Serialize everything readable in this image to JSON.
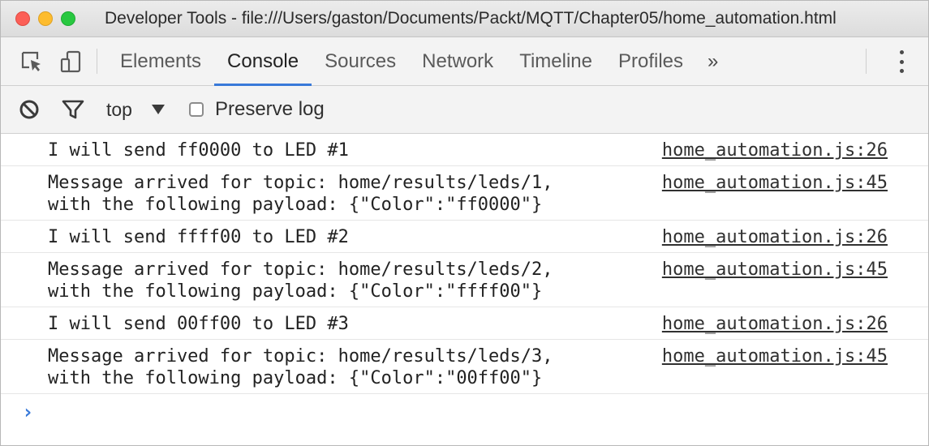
{
  "window": {
    "title": "Developer Tools - file:///Users/gaston/Documents/Packt/MQTT/Chapter05/home_automation.html"
  },
  "tabs": [
    {
      "label": "Elements",
      "active": false
    },
    {
      "label": "Console",
      "active": true
    },
    {
      "label": "Sources",
      "active": false
    },
    {
      "label": "Network",
      "active": false
    },
    {
      "label": "Timeline",
      "active": false
    },
    {
      "label": "Profiles",
      "active": false
    }
  ],
  "more_tabs": "»",
  "filter": {
    "context": "top",
    "preserve_log_label": "Preserve log",
    "preserve_log_checked": false
  },
  "console": {
    "messages": [
      {
        "text": "I will send ff0000 to LED #1",
        "source": "home_automation.js:26"
      },
      {
        "text": "Message arrived for topic: home/results/leds/1,\nwith the following payload: {\"Color\":\"ff0000\"}",
        "source": "home_automation.js:45"
      },
      {
        "text": "I will send ffff00 to LED #2",
        "source": "home_automation.js:26"
      },
      {
        "text": "Message arrived for topic: home/results/leds/2,\nwith the following payload: {\"Color\":\"ffff00\"}",
        "source": "home_automation.js:45"
      },
      {
        "text": "I will send 00ff00 to LED #3",
        "source": "home_automation.js:26"
      },
      {
        "text": "Message arrived for topic: home/results/leds/3,\nwith the following payload: {\"Color\":\"00ff00\"}",
        "source": "home_automation.js:45"
      }
    ],
    "prompt_symbol": "›"
  },
  "colors": {
    "accent": "#3879d9",
    "close": "#fc5f57",
    "minimize": "#fdbc2e",
    "zoom": "#28c840"
  },
  "icons": [
    "inspect-element-icon",
    "device-mode-icon",
    "clear-console-icon",
    "filter-icon",
    "chevron-down-icon",
    "more-options-icon",
    "console-prompt-icon"
  ]
}
